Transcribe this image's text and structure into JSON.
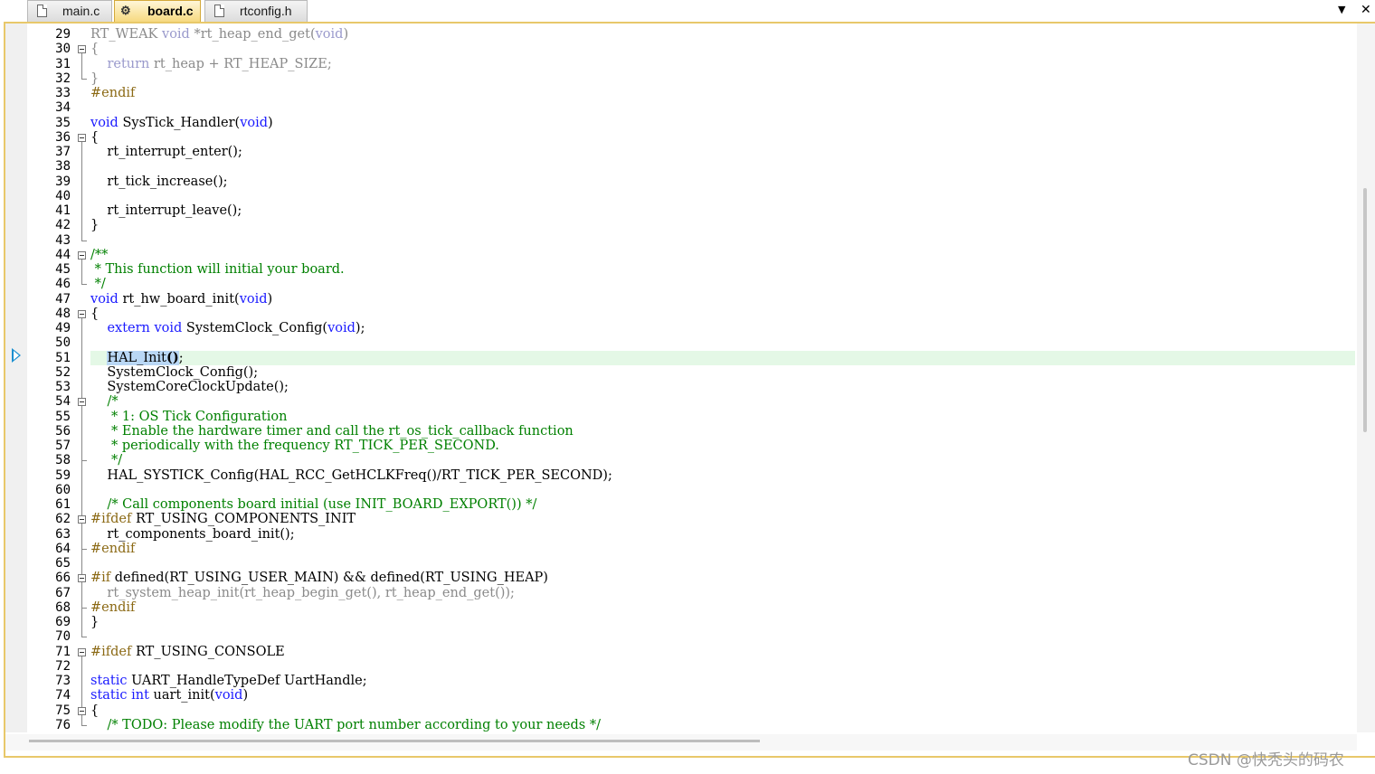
{
  "tabs": [
    {
      "label": "main.c",
      "active": false,
      "icon": "document-icon"
    },
    {
      "label": "board.c",
      "active": true,
      "icon": "gear-document-icon"
    },
    {
      "label": "rtconfig.h",
      "active": false,
      "icon": "document-icon"
    }
  ],
  "tab_controls": {
    "dropdown": "▼",
    "close": "✕"
  },
  "current_line": 51,
  "lines": [
    {
      "n": "29",
      "html": "<span class=\"dim\">RT_WEAK <span class=\"kw\">void</span> *rt_heap_end_get(<span class=\"kw\">void</span>)</span>"
    },
    {
      "n": "30",
      "html": "<span class=\"dim\">{</span>"
    },
    {
      "n": "31",
      "html": "<span class=\"dim\">    <span class=\"kw\">return</span> rt_heap + RT_HEAP_SIZE;</span>"
    },
    {
      "n": "32",
      "html": "<span class=\"dim\">}</span>"
    },
    {
      "n": "33",
      "html": "<span class=\"pp\">#endif</span>"
    },
    {
      "n": "34",
      "html": ""
    },
    {
      "n": "35",
      "html": "<span class=\"kw\">void</span> SysTick_Handler(<span class=\"kw\">void</span>)"
    },
    {
      "n": "36",
      "html": "{"
    },
    {
      "n": "37",
      "html": "    rt_interrupt_enter();"
    },
    {
      "n": "38",
      "html": ""
    },
    {
      "n": "39",
      "html": "    rt_tick_increase();"
    },
    {
      "n": "40",
      "html": ""
    },
    {
      "n": "41",
      "html": "    rt_interrupt_leave();"
    },
    {
      "n": "42",
      "html": "}"
    },
    {
      "n": "43",
      "html": ""
    },
    {
      "n": "44",
      "html": "<span class=\"cm\">/**</span>"
    },
    {
      "n": "45",
      "html": "<span class=\"cm\"> * This function will initial your board.</span>"
    },
    {
      "n": "46",
      "html": "<span class=\"cm\"> */</span>"
    },
    {
      "n": "47",
      "html": "<span class=\"kw\">void</span> rt_hw_board_init(<span class=\"kw\">void</span>)"
    },
    {
      "n": "48",
      "html": "{"
    },
    {
      "n": "49",
      "html": "    <span class=\"kw\">extern</span> <span class=\"kw\">void</span> SystemClock_Config(<span class=\"kw\">void</span>);"
    },
    {
      "n": "50",
      "html": ""
    },
    {
      "n": "51",
      "html": "    <span class=\"sel\">HAL_Init<b>()</b></span>;"
    },
    {
      "n": "52",
      "html": "    SystemClock_Config();"
    },
    {
      "n": "53",
      "html": "    SystemCoreClockUpdate();"
    },
    {
      "n": "54",
      "html": "    <span class=\"cm\">/*</span>"
    },
    {
      "n": "55",
      "html": "<span class=\"cm\">     * 1: OS Tick Configuration</span>"
    },
    {
      "n": "56",
      "html": "<span class=\"cm\">     * Enable the hardware timer and call the rt_os_tick_callback function</span>"
    },
    {
      "n": "57",
      "html": "<span class=\"cm\">     * periodically with the frequency RT_TICK_PER_SECOND.</span>"
    },
    {
      "n": "58",
      "html": "<span class=\"cm\">     */</span>"
    },
    {
      "n": "59",
      "html": "    HAL_SYSTICK_Config(HAL_RCC_GetHCLKFreq()/RT_TICK_PER_SECOND);"
    },
    {
      "n": "60",
      "html": ""
    },
    {
      "n": "61",
      "html": "    <span class=\"cm\">/* Call components board initial (use INIT_BOARD_EXPORT()) */</span>"
    },
    {
      "n": "62",
      "html": "<span class=\"pp\">#ifdef</span> RT_USING_COMPONENTS_INIT"
    },
    {
      "n": "63",
      "html": "    rt_components_board_init();"
    },
    {
      "n": "64",
      "html": "<span class=\"pp\">#endif</span>"
    },
    {
      "n": "65",
      "html": ""
    },
    {
      "n": "66",
      "html": "<span class=\"pp\">#if</span> defined(RT_USING_USER_MAIN) &amp;&amp; defined(RT_USING_HEAP)"
    },
    {
      "n": "67",
      "html": "<span class=\"dim\">    rt_system_heap_init(rt_heap_begin_get(), rt_heap_end_get());</span>"
    },
    {
      "n": "68",
      "html": "<span class=\"pp\">#endif</span>"
    },
    {
      "n": "69",
      "html": "}"
    },
    {
      "n": "70",
      "html": ""
    },
    {
      "n": "71",
      "html": "<span class=\"pp\">#ifdef</span> RT_USING_CONSOLE"
    },
    {
      "n": "72",
      "html": ""
    },
    {
      "n": "73",
      "html": "<span class=\"kw\">static</span> UART_HandleTypeDef UartHandle;"
    },
    {
      "n": "74",
      "html": "<span class=\"kw\">static</span> <span class=\"kw\">int</span> uart_init(<span class=\"kw\">void</span>)"
    },
    {
      "n": "75",
      "html": "{"
    },
    {
      "n": "76",
      "html": "    <span class=\"cm\">/* TODO: Please modify the UART port number according to your needs */</span>"
    }
  ],
  "folds": [
    {
      "box": "30",
      "to": "32"
    },
    {
      "box": "36",
      "to": "43"
    },
    {
      "box": "44",
      "to": "46"
    },
    {
      "box": "48",
      "to": "70"
    },
    {
      "box": "54",
      "to": "58"
    },
    {
      "box": "62",
      "to": "64"
    },
    {
      "box": "66",
      "to": "68"
    },
    {
      "box": "71",
      "to": "76"
    },
    {
      "box": "75",
      "to": "76"
    }
  ],
  "watermark": "CSDN @快秃头的码农"
}
